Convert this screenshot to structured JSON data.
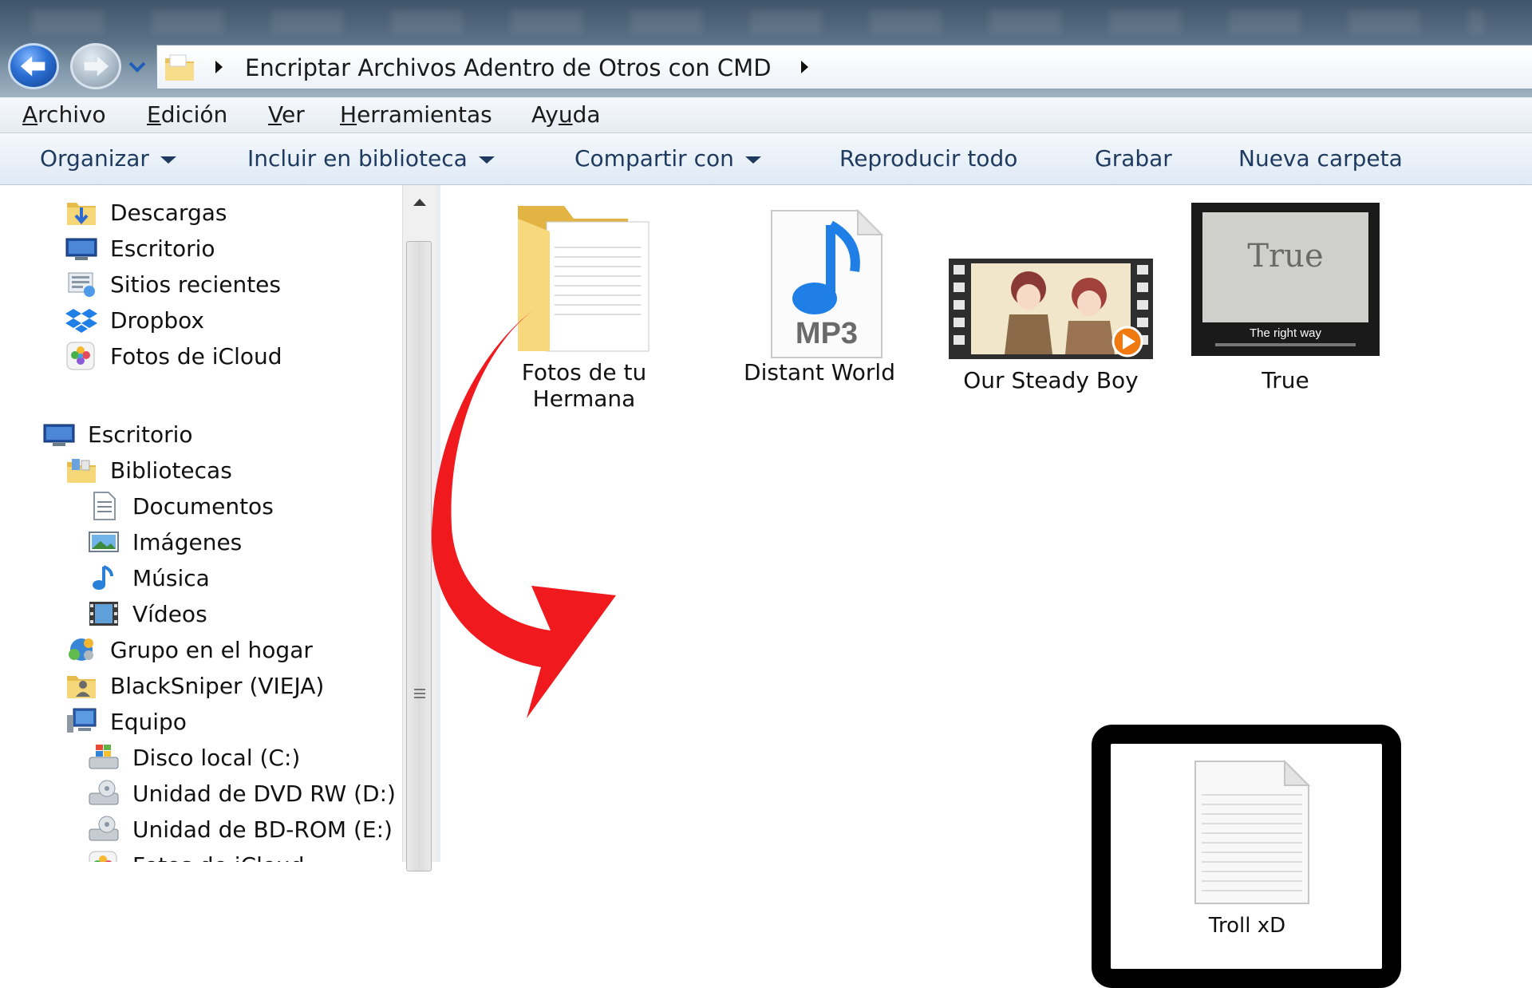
{
  "address_bar": {
    "path": "Encriptar Archivos Adentro de Otros con CMD"
  },
  "menu": [
    {
      "pre": "",
      "ul": "A",
      "post": "rchivo"
    },
    {
      "pre": "",
      "ul": "E",
      "post": "dición"
    },
    {
      "pre": "",
      "ul": "V",
      "post": "er"
    },
    {
      "pre": "",
      "ul": "H",
      "post": "erramientas"
    },
    {
      "pre": "Ay",
      "ul": "u",
      "post": "da"
    }
  ],
  "commands": [
    {
      "label": "Organizar",
      "dropdown": true
    },
    {
      "label": "Incluir en biblioteca",
      "dropdown": true
    },
    {
      "label": "Compartir con",
      "dropdown": true
    },
    {
      "label": "Reproducir todo",
      "dropdown": false
    },
    {
      "label": "Grabar",
      "dropdown": false
    },
    {
      "label": "Nueva carpeta",
      "dropdown": false
    }
  ],
  "nav": [
    {
      "label": "Descargas",
      "icon": "downloads-folder-icon"
    },
    {
      "label": "Escritorio",
      "icon": "desktop-icon"
    },
    {
      "label": "Sitios recientes",
      "icon": "recent-places-icon"
    },
    {
      "label": "Dropbox",
      "icon": "dropbox-icon"
    },
    {
      "label": "Fotos de iCloud",
      "icon": "icloud-photos-icon"
    },
    {
      "label": "Escritorio",
      "icon": "desktop-icon"
    },
    {
      "label": "Bibliotecas",
      "icon": "libraries-icon"
    },
    {
      "label": "Documentos",
      "icon": "documents-icon"
    },
    {
      "label": "Imágenes",
      "icon": "pictures-icon"
    },
    {
      "label": "Música",
      "icon": "music-icon"
    },
    {
      "label": "Vídeos",
      "icon": "videos-icon"
    },
    {
      "label": "Grupo en el hogar",
      "icon": "homegroup-icon"
    },
    {
      "label": "BlackSniper (VIEJA)",
      "icon": "user-folder-icon"
    },
    {
      "label": "Equipo",
      "icon": "computer-icon"
    },
    {
      "label": "Disco local (C:)",
      "icon": "local-disk-icon"
    },
    {
      "label": "Unidad de DVD RW (D:)",
      "icon": "dvd-drive-icon"
    },
    {
      "label": "Unidad de BD-ROM (E:)",
      "icon": "bd-drive-icon"
    },
    {
      "label": "Fotos de iCloud",
      "icon": "icloud-photos-icon"
    }
  ],
  "files": [
    {
      "name_line1": "Fotos de tu",
      "name_line2": "Hermana",
      "icon": "folder-icon"
    },
    {
      "name": "Distant World",
      "icon": "mp3-file-icon",
      "badge": "MP3"
    },
    {
      "name": "Our Steady Boy",
      "icon": "video-file-icon"
    },
    {
      "name": "True",
      "icon": "video-thumbnail-icon",
      "thumb_text": "True",
      "thumb_caption": "The right way"
    },
    {
      "name": "Troll xD",
      "icon": "text-file-icon"
    }
  ],
  "colors": {
    "accent_arrow": "#f0191e",
    "highlight_border": "#000000",
    "command_text": "#1e3a5f"
  }
}
